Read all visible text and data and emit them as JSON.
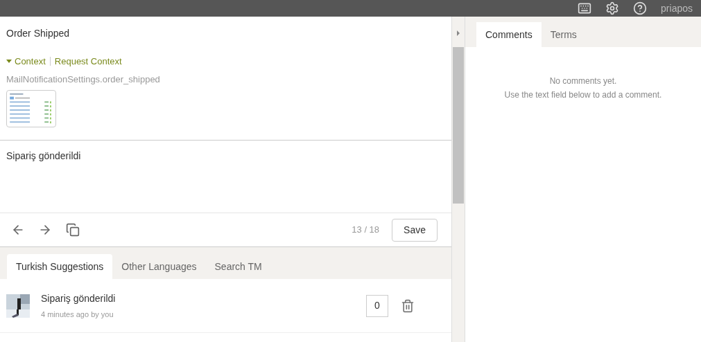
{
  "top_bar": {
    "user": "priapos"
  },
  "string": {
    "title": "Order Shipped",
    "context_expanded": true,
    "context_label": "Context",
    "request_context": "Request Context",
    "key": "MailNotificationSettings.order_shipped"
  },
  "translation": {
    "value": "Sipariş gönderildi"
  },
  "toolbar": {
    "counter": "13 / 18",
    "save": "Save"
  },
  "suggestion_tabs": [
    {
      "label": "Turkish Suggestions",
      "selected": true
    },
    {
      "label": "Other Languages",
      "selected": false
    },
    {
      "label": "Search TM",
      "selected": false
    }
  ],
  "suggestions": [
    {
      "text": "Sipariş gönderildi",
      "meta": "4 minutes ago by you",
      "votes": "0"
    }
  ],
  "side_tabs": [
    {
      "label": "Comments",
      "selected": true
    },
    {
      "label": "Terms",
      "selected": false
    }
  ],
  "comments": {
    "empty_line_1": "No comments yet.",
    "empty_line_2": "Use the text field below to add a comment."
  }
}
